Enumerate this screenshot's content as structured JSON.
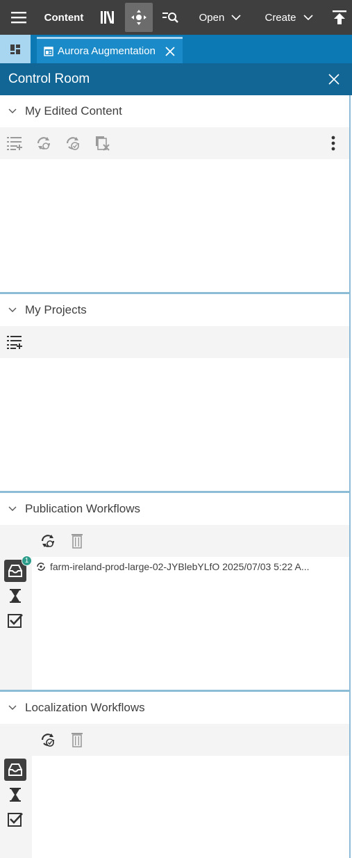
{
  "topbar": {
    "app_label": "Content",
    "open_label": "Open",
    "create_label": "Create"
  },
  "tabs": {
    "active_tab_label": "Aurora Augmentation"
  },
  "control_room": {
    "title": "Control Room"
  },
  "sections": {
    "edited": {
      "title": "My Edited Content"
    },
    "projects": {
      "title": "My Projects"
    },
    "publication": {
      "title": "Publication Workflows",
      "inbox_count": "1",
      "rows": [
        {
          "text": "farm-ireland-prod-large-02-JYBlebYLfO 2025/07/03 5:22 A..."
        }
      ]
    },
    "localization": {
      "title": "Localization Workflows"
    }
  },
  "colors": {
    "topbar": "#3f3f3f",
    "tabbar": "#0c79b5",
    "header": "#126696",
    "divider": "#8cbcd6",
    "badge": "#2d9c8a"
  }
}
